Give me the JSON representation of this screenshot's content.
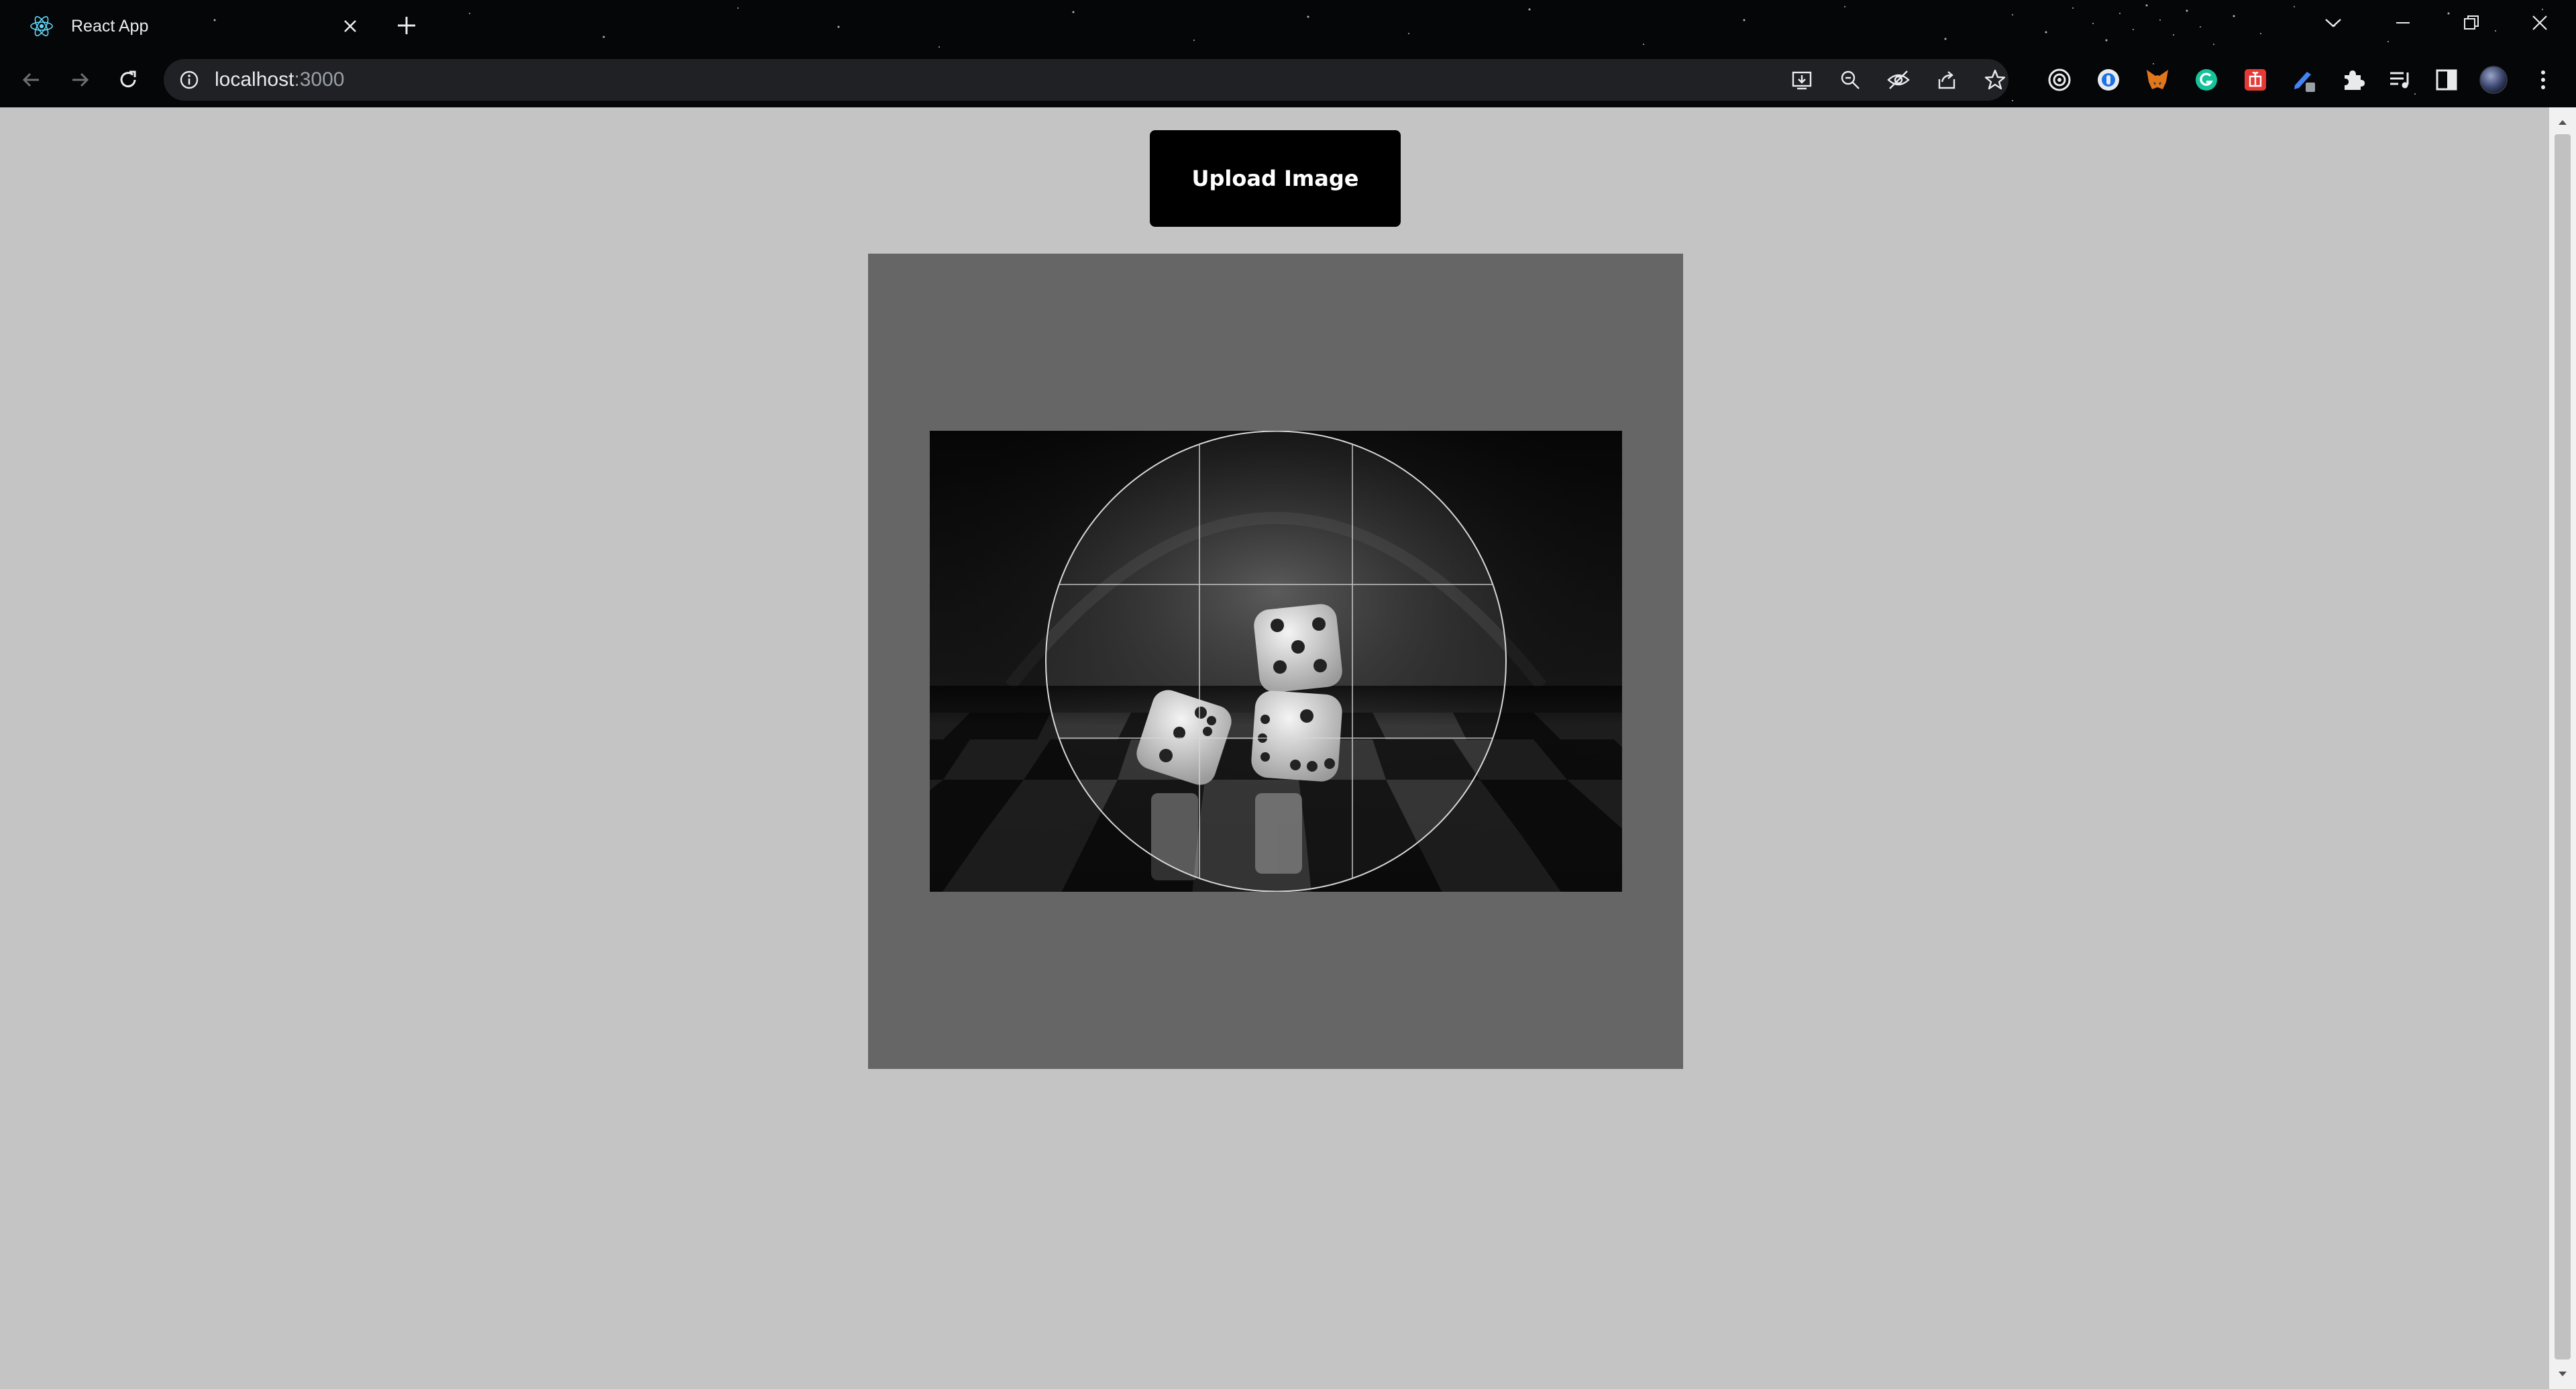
{
  "browser": {
    "tab": {
      "title": "React App",
      "favicon": "react-logo-icon"
    },
    "address_bar": {
      "host": "localhost",
      "port": ":3000"
    },
    "colors": {
      "chrome_bg": "#050608",
      "omnibox_bg": "#202124",
      "text": "#e8eaed"
    }
  },
  "page": {
    "upload_button_label": "Upload Image",
    "colors": {
      "background": "#c4c4c4",
      "crop_container": "#666666",
      "button": "#000000"
    },
    "crop": {
      "shape": "circle",
      "grid": "3x3 rule of thirds"
    },
    "image": {
      "subject": "three dice on a checkerboard",
      "icon": "dice-photo"
    }
  }
}
